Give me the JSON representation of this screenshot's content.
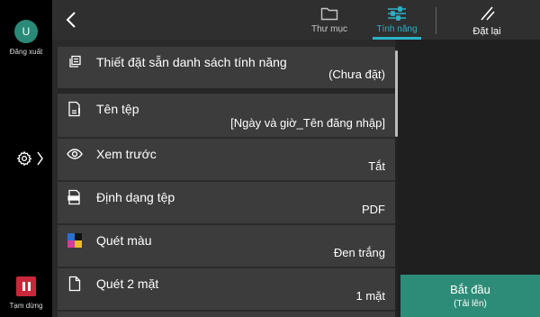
{
  "rail": {
    "avatar_letter": "U",
    "logout_label": "Đăng xuất",
    "pause_label": "Tạm dừng",
    "pause_color": "#c8283a"
  },
  "topbar": {
    "tabs": [
      {
        "label": "Thư mục",
        "icon": "folder-icon"
      },
      {
        "label": "Tính năng",
        "icon": "sliders-icon",
        "active": true
      },
      {
        "label": "Đặt lại",
        "icon": "reset-icon"
      }
    ],
    "accent": "#2bb3c7"
  },
  "items": [
    {
      "title": "Thiết đặt sẵn danh sách tính năng",
      "value": "(Chưa đặt)",
      "icon": "preset-list-icon"
    },
    {
      "title": "Tên tệp",
      "value": "[Ngày và giờ_Tên đăng nhập]",
      "icon": "file-name-icon"
    },
    {
      "title": "Xem trước",
      "value": "Tắt",
      "icon": "eye-icon"
    },
    {
      "title": "Định dạng tệp",
      "value": "PDF",
      "icon": "file-format-icon"
    },
    {
      "title": "Quét màu",
      "value": "Đen trắng",
      "icon": "color-scan-icon"
    },
    {
      "title": "Quét 2 mặt",
      "value": "1 mặt",
      "icon": "duplex-page-icon"
    }
  ],
  "start": {
    "label": "Bắt đầu",
    "sublabel": "(Tải lên)",
    "color": "#2d8c77"
  }
}
